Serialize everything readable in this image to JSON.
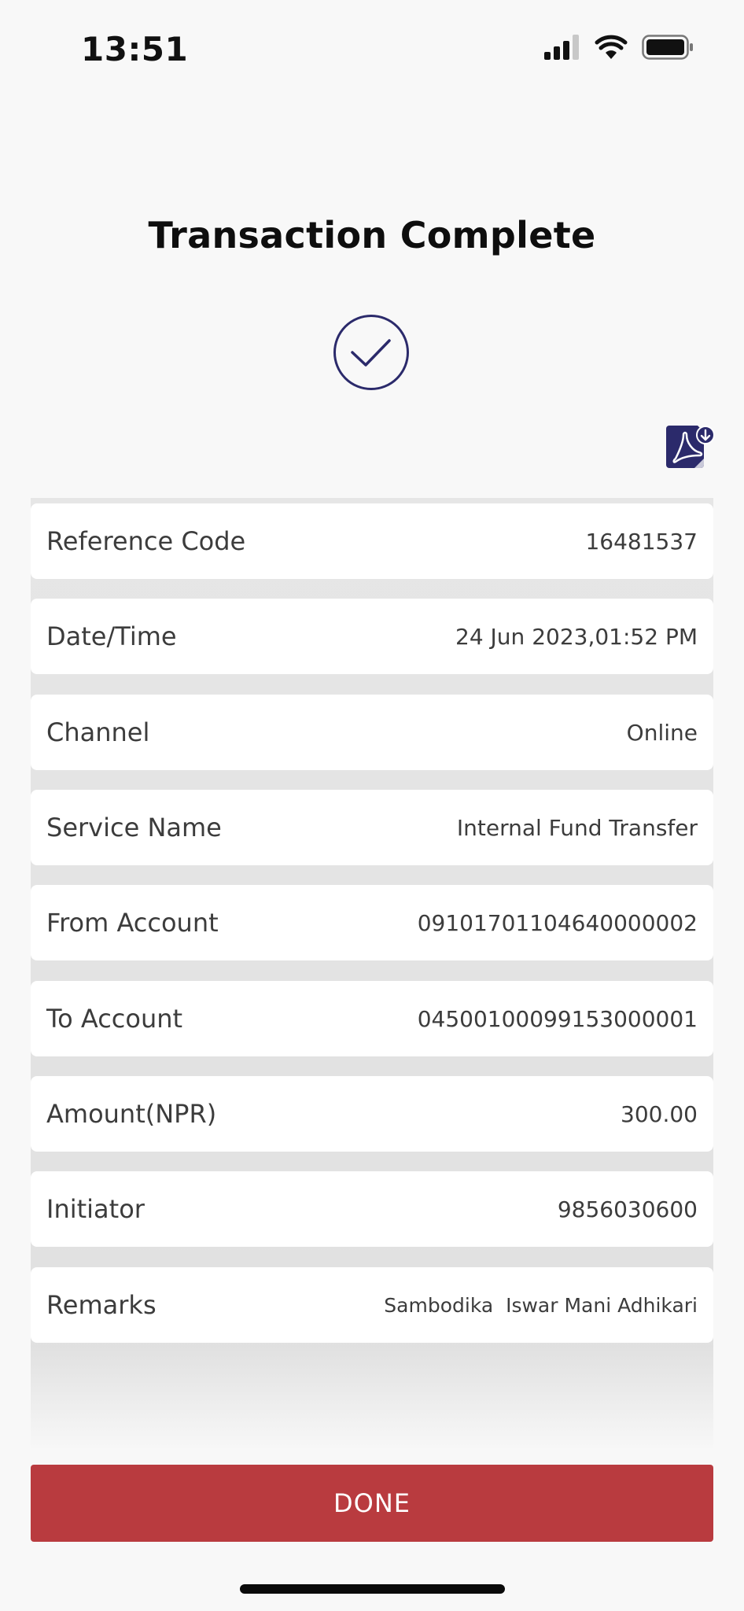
{
  "status_bar": {
    "time": "13:51",
    "icons": [
      "cellular-signal-icon",
      "wifi-icon",
      "battery-icon"
    ]
  },
  "page": {
    "title": "Transaction Complete",
    "success_icon": "check-circle-icon",
    "download_icon": "pdf-download-icon"
  },
  "details": {
    "reference_code": {
      "label": "Reference Code",
      "value": "16481537"
    },
    "date_time": {
      "label": "Date/Time",
      "value": "24 Jun 2023,01:52 PM"
    },
    "channel": {
      "label": "Channel",
      "value": "Online"
    },
    "service_name": {
      "label": "Service Name",
      "value": "Internal Fund Transfer"
    },
    "from_account": {
      "label": "From Account",
      "value": "09101701104640000002"
    },
    "to_account": {
      "label": "To Account",
      "value": "04500100099153000001"
    },
    "amount": {
      "label": "Amount(NPR)",
      "value": "300.00"
    },
    "initiator": {
      "label": "Initiator",
      "value": "9856030600"
    },
    "remarks": {
      "label": "Remarks",
      "value": "Sambodika  Iswar Mani Adhikari"
    }
  },
  "actions": {
    "done_label": "DONE"
  },
  "colors": {
    "accent": "#b93b3f",
    "icon_navy": "#2b2a6b",
    "background": "#f8f8f8",
    "row_background": "#ffffff"
  }
}
